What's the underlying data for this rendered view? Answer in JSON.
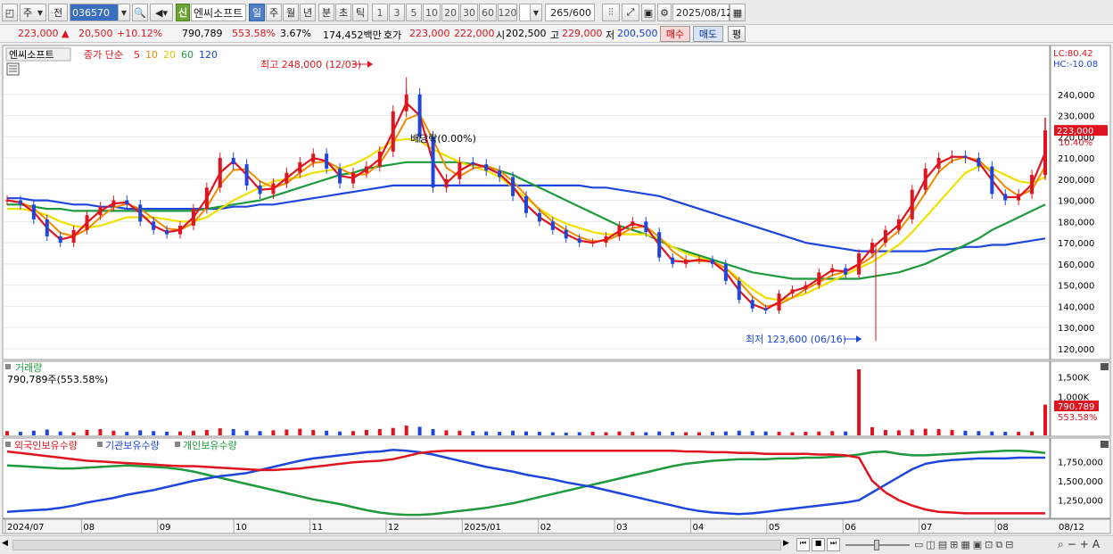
{
  "toolbar": {
    "mode_label": "주",
    "prev_label": "전",
    "code_value": "036570",
    "shin_label": "신",
    "stock_name": "엔씨소프트",
    "periods": [
      "일",
      "주",
      "월",
      "년",
      "분",
      "초",
      "틱"
    ],
    "selected_period": "일",
    "intervals": [
      "1",
      "3",
      "5",
      "10",
      "20",
      "30",
      "60",
      "120"
    ],
    "count_label": "265/600",
    "date_value": "2025/08/12"
  },
  "quote": {
    "price": "223,000",
    "change": "20,500",
    "change_pct": "+10.12%",
    "volume": "790,789",
    "volume_ratio": "553.58%",
    "turnover_pct": "3.67%",
    "amount": "174,452백만",
    "ask_label": "호가",
    "ask": "223,000",
    "bid": "222,000",
    "open_label": "시",
    "open": "202,500",
    "high_label": "고",
    "high": "229,000",
    "low_label": "저",
    "low": "200,500",
    "buy_label": "매수",
    "sell_label": "매도",
    "eval_label": "평"
  },
  "chart_data": [
    {
      "type": "candlestick",
      "title": "엔씨소프트",
      "ma_label": "종가 단순",
      "ma_periods": [
        "5",
        "10",
        "20",
        "60",
        "120"
      ],
      "ma_colors": [
        "#e0141e",
        "#f08c00",
        "#f0e000",
        "#1e9a3c",
        "#1e46dc"
      ],
      "lc_label": "LC:80.42",
      "hc_label": "HC:-10.08",
      "y_ticks": [
        "240,000",
        "230,000",
        "220,000",
        "210,000",
        "200,000",
        "190,000",
        "180,000",
        "170,000",
        "160,000",
        "150,000",
        "140,000",
        "130,000",
        "120,000"
      ],
      "ylim": [
        117000,
        250000
      ],
      "current_price_label": "223,000",
      "current_pct_label": "10.40%",
      "high_annotation": "최고 248,000 (12/03)",
      "low_annotation": "최저 123,600 (06/16)",
      "dividend_annotation": "배당락(0.00%)",
      "x_labels": [
        "2024/07",
        "08",
        "09",
        "10",
        "11",
        "12",
        "2025/01",
        "02",
        "03",
        "04",
        "05",
        "06",
        "07",
        "08"
      ],
      "x_right_label": "08/12",
      "closes": [
        190000,
        188000,
        181000,
        173000,
        170000,
        176000,
        183000,
        187000,
        190000,
        188000,
        180000,
        176000,
        174000,
        178000,
        186000,
        196000,
        210000,
        207000,
        197000,
        193000,
        198000,
        203000,
        208000,
        212000,
        205000,
        198000,
        203000,
        206000,
        213000,
        232000,
        240000,
        220000,
        196000,
        200000,
        208000,
        207000,
        204000,
        201000,
        192000,
        184000,
        180000,
        176000,
        172000,
        170000,
        170000,
        173000,
        178000,
        180000,
        175000,
        163000,
        160000,
        162000,
        162000,
        160000,
        152000,
        143000,
        139000,
        138000,
        146000,
        148000,
        150000,
        156000,
        158000,
        155000,
        165000,
        170000,
        176000,
        181000,
        195000,
        205000,
        210000,
        211000,
        210000,
        206000,
        193000,
        190000,
        193000,
        202000,
        223000
      ],
      "ma20": [
        186000,
        186000,
        185000,
        183000,
        180000,
        178000,
        177000,
        178000,
        180000,
        182000,
        182000,
        182000,
        181000,
        180000,
        180000,
        182000,
        186000,
        190000,
        193000,
        196000,
        199000,
        200000,
        201000,
        203000,
        204000,
        205000,
        207000,
        210000,
        214000,
        218000,
        219000,
        218000,
        214000,
        211000,
        208000,
        206000,
        204000,
        201000,
        196000,
        191000,
        186000,
        182000,
        179000,
        177000,
        175000,
        174000,
        174000,
        174000,
        174000,
        172000,
        168000,
        165000,
        163000,
        161000,
        158000,
        153000,
        148000,
        144000,
        143000,
        144000,
        146000,
        149000,
        152000,
        155000,
        158000,
        161000,
        165000,
        169000,
        175000,
        182000,
        189000,
        196000,
        203000,
        206000,
        205000,
        202000,
        199000,
        198000,
        201000
      ],
      "ma60": [
        188000,
        188000,
        187000,
        186000,
        186000,
        185000,
        185000,
        185000,
        185000,
        185000,
        185000,
        185000,
        185000,
        185000,
        185000,
        186000,
        187000,
        188000,
        189000,
        190000,
        192000,
        194000,
        196000,
        198000,
        200000,
        202000,
        203000,
        205000,
        206000,
        207000,
        208000,
        208000,
        208000,
        208000,
        208000,
        207000,
        206000,
        204000,
        202000,
        199000,
        196000,
        193000,
        190000,
        187000,
        184000,
        181000,
        178000,
        176000,
        174000,
        171000,
        168000,
        166000,
        164000,
        162000,
        160000,
        158000,
        156000,
        155000,
        154000,
        153000,
        153000,
        153000,
        153000,
        153000,
        153000,
        154000,
        155000,
        156000,
        158000,
        160000,
        163000,
        166000,
        169000,
        172000,
        176000,
        179000,
        182000,
        185000,
        188000
      ],
      "ma120": [
        191000,
        191000,
        190000,
        190000,
        189000,
        188000,
        188000,
        187000,
        187000,
        186000,
        186000,
        186000,
        186000,
        186000,
        186000,
        186000,
        186000,
        187000,
        187000,
        188000,
        188000,
        189000,
        190000,
        191000,
        192000,
        193000,
        194000,
        195000,
        196000,
        197000,
        197000,
        197000,
        197000,
        197000,
        197000,
        197000,
        197000,
        197000,
        197000,
        197000,
        197000,
        197000,
        197000,
        197000,
        196000,
        196000,
        195000,
        194000,
        193000,
        192000,
        190000,
        188000,
        186000,
        184000,
        182000,
        180000,
        178000,
        176000,
        174000,
        172000,
        170000,
        169000,
        168000,
        167000,
        166000,
        166000,
        166000,
        166000,
        166000,
        166000,
        167000,
        167000,
        168000,
        168000,
        169000,
        169000,
        170000,
        171000,
        172000
      ]
    },
    {
      "type": "bar",
      "title": "거래량",
      "summary": "790,789주(553.58%)",
      "y_ticks": [
        "1,500K",
        "1,000K"
      ],
      "ylim": [
        0,
        1700000
      ],
      "current_label": "790,789",
      "current_pct": "553.58%",
      "values": [
        110000,
        90000,
        120000,
        150000,
        100000,
        80000,
        140000,
        160000,
        120000,
        90000,
        130000,
        110000,
        95000,
        100000,
        120000,
        140000,
        180000,
        160000,
        120000,
        110000,
        130000,
        150000,
        170000,
        140000,
        120000,
        100000,
        110000,
        140000,
        160000,
        190000,
        250000,
        220000,
        160000,
        130000,
        120000,
        110000,
        100000,
        90000,
        120000,
        100000,
        90000,
        80000,
        70000,
        80000,
        90000,
        80000,
        100000,
        90000,
        80000,
        100000,
        90000,
        80000,
        80000,
        90000,
        100000,
        120000,
        110000,
        100000,
        90000,
        80000,
        90000,
        100000,
        110000,
        100000,
        1700000,
        210000,
        140000,
        130000,
        150000,
        170000,
        160000,
        140000,
        120000,
        110000,
        100000,
        90000,
        90000,
        100000,
        790789
      ]
    },
    {
      "type": "line",
      "series_names": [
        "외국인보유수량",
        "기관보유수량",
        "개인보유수량"
      ],
      "series_colors": [
        "#e0141e",
        "#1e46dc",
        "#1e9a3c"
      ],
      "y_ticks": [
        "1,750,000",
        "1,500,000",
        "1,250,000"
      ],
      "ylim": [
        1050000,
        1950000
      ],
      "foreign": [
        1880000,
        1860000,
        1840000,
        1820000,
        1800000,
        1780000,
        1760000,
        1750000,
        1740000,
        1730000,
        1720000,
        1710000,
        1700000,
        1690000,
        1690000,
        1680000,
        1670000,
        1660000,
        1650000,
        1640000,
        1640000,
        1650000,
        1660000,
        1680000,
        1700000,
        1720000,
        1740000,
        1750000,
        1760000,
        1780000,
        1820000,
        1860000,
        1880000,
        1890000,
        1890000,
        1890000,
        1890000,
        1890000,
        1890000,
        1890000,
        1890000,
        1890000,
        1890000,
        1890000,
        1890000,
        1890000,
        1890000,
        1890000,
        1890000,
        1890000,
        1890000,
        1880000,
        1880000,
        1870000,
        1870000,
        1860000,
        1860000,
        1850000,
        1850000,
        1850000,
        1850000,
        1840000,
        1840000,
        1830000,
        1800000,
        1500000,
        1350000,
        1250000,
        1180000,
        1130000,
        1100000,
        1090000,
        1080000,
        1080000,
        1080000,
        1080000,
        1080000,
        1080000,
        1080000
      ],
      "institution": [
        1100000,
        1110000,
        1120000,
        1130000,
        1150000,
        1180000,
        1220000,
        1250000,
        1280000,
        1320000,
        1350000,
        1380000,
        1420000,
        1460000,
        1500000,
        1530000,
        1560000,
        1580000,
        1600000,
        1640000,
        1680000,
        1720000,
        1760000,
        1790000,
        1810000,
        1830000,
        1850000,
        1870000,
        1880000,
        1900000,
        1890000,
        1870000,
        1840000,
        1800000,
        1760000,
        1720000,
        1680000,
        1650000,
        1620000,
        1580000,
        1550000,
        1520000,
        1480000,
        1450000,
        1420000,
        1380000,
        1340000,
        1300000,
        1260000,
        1220000,
        1180000,
        1140000,
        1110000,
        1090000,
        1080000,
        1070000,
        1080000,
        1100000,
        1120000,
        1140000,
        1160000,
        1180000,
        1200000,
        1220000,
        1250000,
        1350000,
        1450000,
        1550000,
        1650000,
        1720000,
        1750000,
        1770000,
        1780000,
        1790000,
        1790000,
        1790000,
        1800000,
        1800000,
        1800000
      ],
      "individual": [
        1700000,
        1690000,
        1680000,
        1670000,
        1660000,
        1660000,
        1670000,
        1680000,
        1690000,
        1700000,
        1690000,
        1680000,
        1670000,
        1650000,
        1620000,
        1580000,
        1540000,
        1500000,
        1460000,
        1420000,
        1380000,
        1340000,
        1300000,
        1260000,
        1230000,
        1200000,
        1160000,
        1120000,
        1090000,
        1070000,
        1060000,
        1060000,
        1070000,
        1090000,
        1110000,
        1130000,
        1150000,
        1180000,
        1210000,
        1250000,
        1290000,
        1330000,
        1370000,
        1410000,
        1450000,
        1490000,
        1530000,
        1570000,
        1610000,
        1650000,
        1690000,
        1720000,
        1740000,
        1760000,
        1770000,
        1780000,
        1780000,
        1780000,
        1790000,
        1790000,
        1800000,
        1800000,
        1810000,
        1820000,
        1840000,
        1870000,
        1880000,
        1850000,
        1830000,
        1830000,
        1840000,
        1850000,
        1860000,
        1870000,
        1880000,
        1890000,
        1890000,
        1880000,
        1860000
      ]
    }
  ]
}
